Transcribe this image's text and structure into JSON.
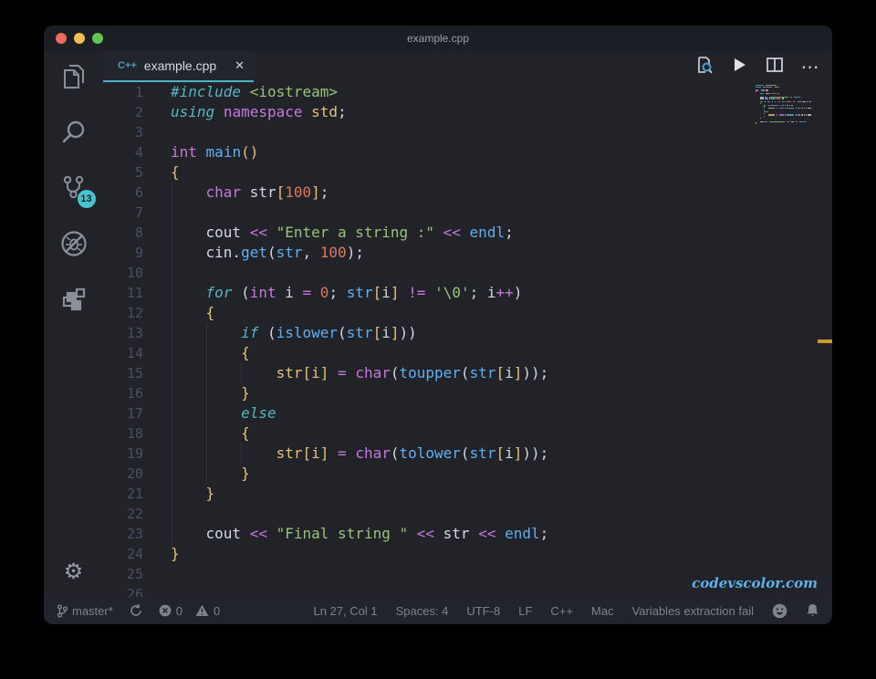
{
  "window": {
    "title": "example.cpp"
  },
  "traffic_lights": {
    "close": "#ee6a5f",
    "minimize": "#f5bd4f",
    "zoom": "#61c554"
  },
  "activity": {
    "badge": "13",
    "settings_glyph": "⚙",
    "items": [
      "explorer",
      "search",
      "source-control",
      "debug-disabled",
      "extensions"
    ]
  },
  "tab": {
    "label": "example.cpp",
    "icon_label": "C++",
    "close_glyph": "✕"
  },
  "editor_actions": {
    "more_glyph": "⋯"
  },
  "colors": {
    "tab_accent": "#4fb3c6",
    "badge": "#49c3cd",
    "overview_mark": "#cf9b2a",
    "tokens": {
      "wh": "#d4d8e0",
      "kw": "#56b6c2",
      "pur": "#c678dd",
      "blu": "#61afef",
      "gold": "#e5c07b",
      "grn": "#98c379",
      "num": "#e0765e"
    }
  },
  "code": {
    "visible_line_count": 26,
    "lines": [
      {
        "n": 1,
        "t": [
          [
            "kw",
            "#include"
          ],
          [
            "wh",
            " "
          ],
          [
            "grn",
            "<iostream>"
          ]
        ]
      },
      {
        "n": 2,
        "t": [
          [
            "kw",
            "using"
          ],
          [
            "wh",
            " "
          ],
          [
            "pur",
            "namespace"
          ],
          [
            "wh",
            " "
          ],
          [
            "gold",
            "std"
          ],
          [
            "wh",
            ";"
          ]
        ]
      },
      {
        "n": 3,
        "t": []
      },
      {
        "n": 4,
        "t": [
          [
            "pur",
            "int"
          ],
          [
            "wh",
            " "
          ],
          [
            "blu",
            "main"
          ],
          [
            "gold",
            "()"
          ]
        ]
      },
      {
        "n": 5,
        "t": [
          [
            "gold",
            "{"
          ]
        ]
      },
      {
        "n": 6,
        "t": [
          [
            "wh",
            "    "
          ],
          [
            "pur",
            "char"
          ],
          [
            "wh",
            " str"
          ],
          [
            "gold",
            "["
          ],
          [
            "num",
            "100"
          ],
          [
            "gold",
            "]"
          ],
          [
            "wh",
            ";"
          ]
        ]
      },
      {
        "n": 7,
        "t": []
      },
      {
        "n": 8,
        "t": [
          [
            "wh",
            "    cout "
          ],
          [
            "pur",
            "<<"
          ],
          [
            "wh",
            " "
          ],
          [
            "grn",
            "\"Enter a string :\""
          ],
          [
            "wh",
            " "
          ],
          [
            "pur",
            "<<"
          ],
          [
            "wh",
            " "
          ],
          [
            "blu",
            "endl"
          ],
          [
            "wh",
            ";"
          ]
        ]
      },
      {
        "n": 9,
        "t": [
          [
            "wh",
            "    cin."
          ],
          [
            "blu",
            "get"
          ],
          [
            "wh",
            "("
          ],
          [
            "blu",
            "str"
          ],
          [
            "wh",
            ", "
          ],
          [
            "num",
            "100"
          ],
          [
            "wh",
            ");"
          ]
        ]
      },
      {
        "n": 10,
        "t": []
      },
      {
        "n": 11,
        "t": [
          [
            "wh",
            "    "
          ],
          [
            "kw",
            "for"
          ],
          [
            "wh",
            " ("
          ],
          [
            "pur",
            "int"
          ],
          [
            "wh",
            " i "
          ],
          [
            "pur",
            "="
          ],
          [
            "wh",
            " "
          ],
          [
            "num",
            "0"
          ],
          [
            "wh",
            "; "
          ],
          [
            "blu",
            "str"
          ],
          [
            "gold",
            "["
          ],
          [
            "wh",
            "i"
          ],
          [
            "gold",
            "]"
          ],
          [
            "wh",
            " "
          ],
          [
            "pur",
            "!="
          ],
          [
            "wh",
            " "
          ],
          [
            "grn",
            "'\\0'"
          ],
          [
            "wh",
            "; i"
          ],
          [
            "pur",
            "++"
          ],
          [
            "wh",
            ")"
          ]
        ]
      },
      {
        "n": 12,
        "t": [
          [
            "wh",
            "    "
          ],
          [
            "gold",
            "{"
          ]
        ]
      },
      {
        "n": 13,
        "t": [
          [
            "wh",
            "        "
          ],
          [
            "kw",
            "if"
          ],
          [
            "wh",
            " ("
          ],
          [
            "blu",
            "islower"
          ],
          [
            "wh",
            "("
          ],
          [
            "blu",
            "str"
          ],
          [
            "gold",
            "["
          ],
          [
            "wh",
            "i"
          ],
          [
            "gold",
            "]"
          ],
          [
            "wh",
            "))"
          ]
        ]
      },
      {
        "n": 14,
        "t": [
          [
            "wh",
            "        "
          ],
          [
            "gold",
            "{"
          ]
        ]
      },
      {
        "n": 15,
        "t": [
          [
            "wh",
            "            "
          ],
          [
            "gold",
            "str[i]"
          ],
          [
            "wh",
            " "
          ],
          [
            "pur",
            "="
          ],
          [
            "wh",
            " "
          ],
          [
            "pur",
            "char"
          ],
          [
            "wh",
            "("
          ],
          [
            "blu",
            "toupper"
          ],
          [
            "wh",
            "("
          ],
          [
            "blu",
            "str"
          ],
          [
            "gold",
            "["
          ],
          [
            "wh",
            "i"
          ],
          [
            "gold",
            "]"
          ],
          [
            "wh",
            "));"
          ]
        ]
      },
      {
        "n": 16,
        "t": [
          [
            "wh",
            "        "
          ],
          [
            "gold",
            "}"
          ]
        ]
      },
      {
        "n": 17,
        "t": [
          [
            "wh",
            "        "
          ],
          [
            "kw",
            "else"
          ]
        ]
      },
      {
        "n": 18,
        "t": [
          [
            "wh",
            "        "
          ],
          [
            "gold",
            "{"
          ]
        ]
      },
      {
        "n": 19,
        "t": [
          [
            "wh",
            "            "
          ],
          [
            "gold",
            "str[i]"
          ],
          [
            "wh",
            " "
          ],
          [
            "pur",
            "="
          ],
          [
            "wh",
            " "
          ],
          [
            "pur",
            "char"
          ],
          [
            "wh",
            "("
          ],
          [
            "blu",
            "tolower"
          ],
          [
            "wh",
            "("
          ],
          [
            "blu",
            "str"
          ],
          [
            "gold",
            "["
          ],
          [
            "wh",
            "i"
          ],
          [
            "gold",
            "]"
          ],
          [
            "wh",
            "));"
          ]
        ]
      },
      {
        "n": 20,
        "t": [
          [
            "wh",
            "        "
          ],
          [
            "gold",
            "}"
          ]
        ]
      },
      {
        "n": 21,
        "t": [
          [
            "wh",
            "    "
          ],
          [
            "gold",
            "}"
          ]
        ]
      },
      {
        "n": 22,
        "t": []
      },
      {
        "n": 23,
        "t": [
          [
            "wh",
            "    cout "
          ],
          [
            "pur",
            "<<"
          ],
          [
            "wh",
            " "
          ],
          [
            "grn",
            "\"Final string \""
          ],
          [
            "wh",
            " "
          ],
          [
            "pur",
            "<<"
          ],
          [
            "wh",
            " str "
          ],
          [
            "pur",
            "<<"
          ],
          [
            "wh",
            " "
          ],
          [
            "blu",
            "endl"
          ],
          [
            "wh",
            ";"
          ]
        ]
      },
      {
        "n": 24,
        "t": [
          [
            "gold",
            "}"
          ]
        ]
      },
      {
        "n": 25,
        "t": []
      },
      {
        "n": 26,
        "t": []
      }
    ]
  },
  "watermark": {
    "text": "codevscolor.com"
  },
  "status": {
    "branch": "master*",
    "errors": "0",
    "warnings": "0",
    "ln_col": "Ln 27, Col 1",
    "spaces": "Spaces: 4",
    "encoding": "UTF-8",
    "eol": "LF",
    "language": "C++",
    "mode": "Mac",
    "message": "Variables extraction fail"
  }
}
